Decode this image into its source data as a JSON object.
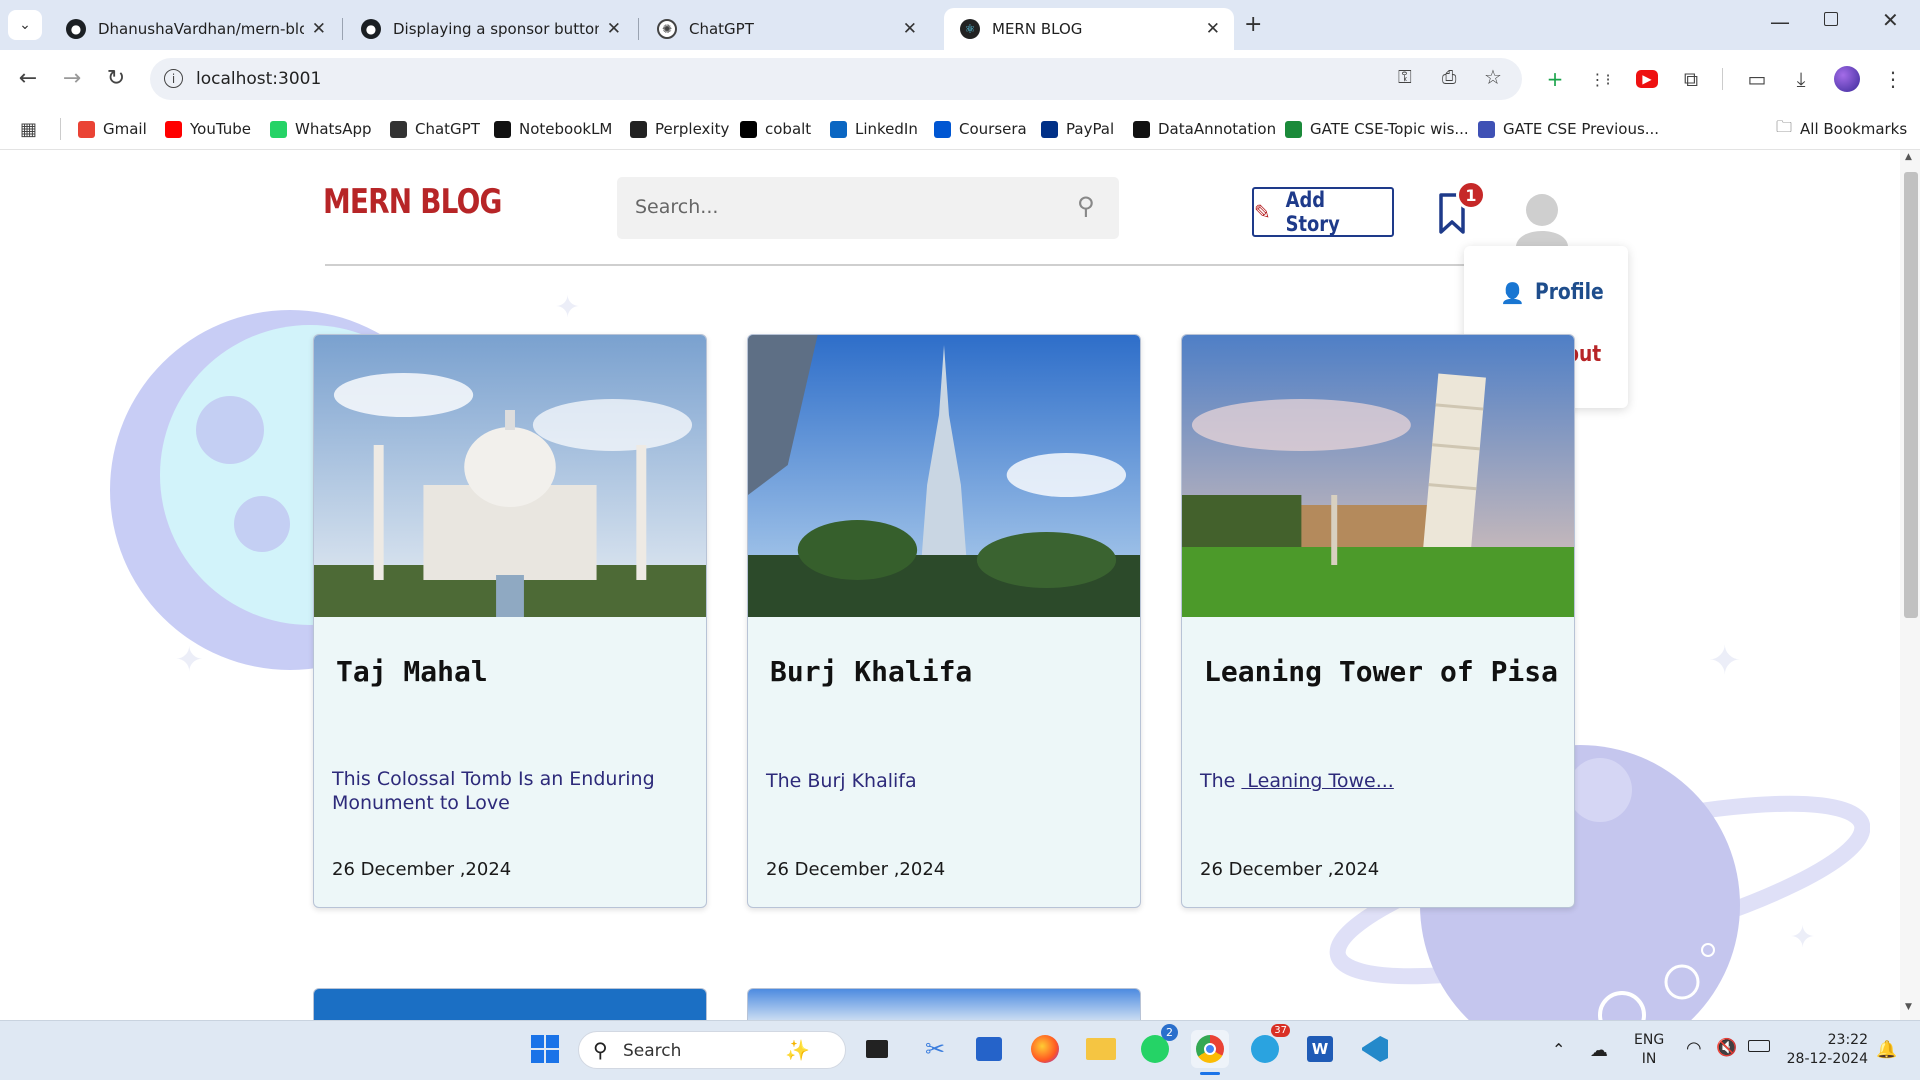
{
  "browser": {
    "tabs": [
      {
        "label": "DhanushaVardhan/mern-blog",
        "icon": "github-icon"
      },
      {
        "label": "Displaying a sponsor button in",
        "icon": "github-icon"
      },
      {
        "label": "ChatGPT",
        "icon": "chatgpt-icon"
      },
      {
        "label": "MERN BLOG",
        "icon": "react-icon"
      }
    ],
    "url": "localhost:3001",
    "bookmarks": [
      {
        "label": "Gmail",
        "color": "#ea4335"
      },
      {
        "label": "YouTube",
        "color": "#ff0000"
      },
      {
        "label": "WhatsApp",
        "color": "#25d366"
      },
      {
        "label": "ChatGPT",
        "color": "#333333"
      },
      {
        "label": "NotebookLM",
        "color": "#111111"
      },
      {
        "label": "Perplexity",
        "color": "#222222"
      },
      {
        "label": "cobalt",
        "color": "#000000"
      },
      {
        "label": "LinkedIn",
        "color": "#0a66c2"
      },
      {
        "label": "Coursera",
        "color": "#0056d2"
      },
      {
        "label": "PayPal",
        "color": "#003087"
      },
      {
        "label": "DataAnnotation",
        "color": "#111111"
      },
      {
        "label": "GATE CSE-Topic wis...",
        "color": "#1b8a3a"
      },
      {
        "label": "GATE CSE Previous...",
        "color": "#3f51b5"
      }
    ],
    "all_bookmarks": "All Bookmarks"
  },
  "header": {
    "logo": "MERN BLOG",
    "search_placeholder": "Search...",
    "add_story": "Add Story",
    "reading_list_badge": "1"
  },
  "user_menu": {
    "profile": "Profile",
    "logout": "Logout"
  },
  "stories": [
    {
      "title": "Taj Mahal",
      "excerpt": "This Colossal Tomb Is an Enduring Monument to Love",
      "date": "26 December ,2024"
    },
    {
      "title": "Burj Khalifa",
      "excerpt": "The Burj Khalifa",
      "date": "26 December ,2024"
    },
    {
      "title": "Leaning Tower of Pisa",
      "excerpt_prefix": "The ",
      "excerpt_link": " Leaning Towe...",
      "date": "26 December ,2024"
    }
  ],
  "taskbar": {
    "search_label": "Search",
    "whatsapp_badge": "2",
    "telegram_badge": "37",
    "language": "ENG",
    "region": "IN",
    "time": "23:22",
    "date": "28-12-2024"
  },
  "colors": {
    "brand": "#b72527",
    "accent": "#1e3a8a",
    "badge": "#c62828"
  }
}
